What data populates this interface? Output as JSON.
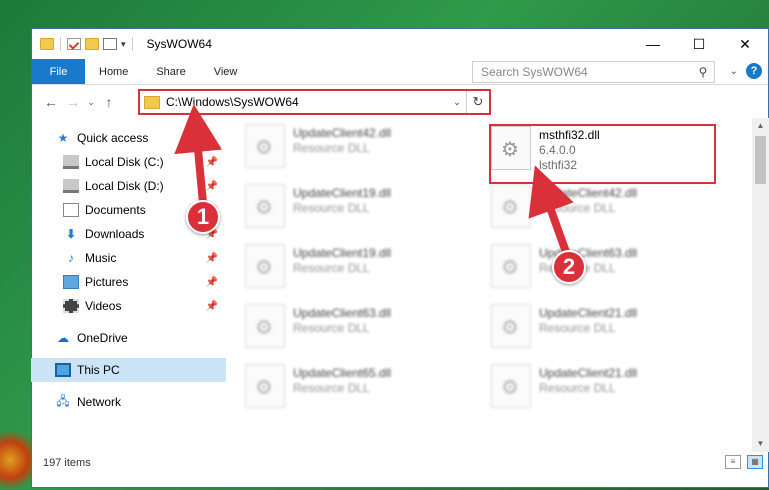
{
  "window": {
    "title": "SysWOW64",
    "controls": {
      "minimize": "—",
      "maximize": "☐",
      "close": "✕"
    }
  },
  "ribbon": {
    "tabs": [
      "File",
      "Home",
      "Share",
      "View"
    ],
    "help": "?"
  },
  "address": {
    "path": "C:\\Windows\\SysWOW64"
  },
  "search": {
    "placeholder": "Search SysWOW64"
  },
  "nav": {
    "quick_access": "Quick access",
    "items": [
      {
        "label": "Local Disk (C:)",
        "pinned": true
      },
      {
        "label": "Local Disk (D:)",
        "pinned": true
      },
      {
        "label": "Documents",
        "pinned": true
      },
      {
        "label": "Downloads",
        "pinned": true
      },
      {
        "label": "Music",
        "pinned": true
      },
      {
        "label": "Pictures",
        "pinned": true
      },
      {
        "label": "Videos",
        "pinned": true
      }
    ],
    "onedrive": "OneDrive",
    "this_pc": "This PC",
    "network": "Network"
  },
  "files": {
    "left_column": [
      {
        "name": "UpdateClient42.dll",
        "desc": "Resource DLL"
      },
      {
        "name": "UpdateClient19.dll",
        "desc": "Resource DLL"
      },
      {
        "name": "UpdateClient19.dll",
        "desc": "Resource DLL"
      },
      {
        "name": "UpdateClient63.dll",
        "desc": "Resource DLL"
      },
      {
        "name": "UpdateClient65.dll",
        "desc": "Resource DLL"
      }
    ],
    "highlighted": {
      "name": "msthfi32.dll",
      "version": "6.4.0.0",
      "desc": "lsthfi32"
    },
    "right_column": [
      {
        "name": "UpdateClient42.dll",
        "desc": "Resource DLL"
      },
      {
        "name": "UpdateClient63.dll",
        "desc": "Resource DLL"
      },
      {
        "name": "UpdateClient21.dll",
        "desc": "Resource DLL"
      },
      {
        "name": "UpdateClient21.dll",
        "desc": "Resource DLL"
      }
    ]
  },
  "status": {
    "count": "197 items"
  },
  "annotations": {
    "marker1": "1",
    "marker2": "2",
    "accent_color": "#d9303a"
  }
}
